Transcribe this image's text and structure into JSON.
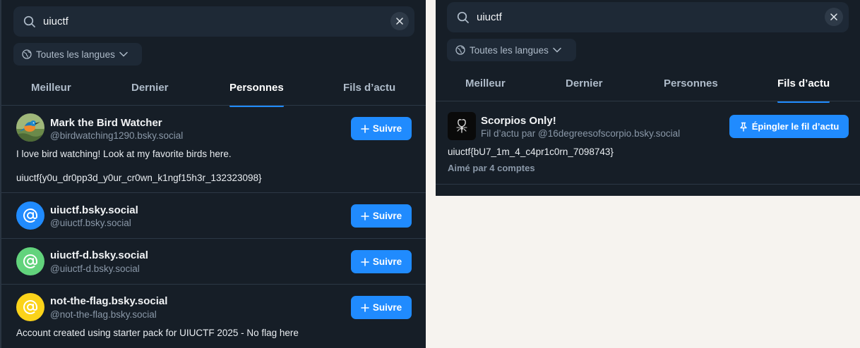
{
  "left": {
    "search": {
      "query": "uiuctf"
    },
    "language_filter": {
      "label": "Toutes les langues"
    },
    "tabs": [
      {
        "label": "Meilleur"
      },
      {
        "label": "Dernier"
      },
      {
        "label": "Personnes",
        "active": true
      },
      {
        "label": "Fils d’actu"
      }
    ],
    "follow_label": "Suivre",
    "people": [
      {
        "name": "Mark the Bird Watcher",
        "handle": "@birdwatching1290.bsky.social",
        "bio_line1": "I love bird watching! Look at my favorite birds here.",
        "bio_line2": "uiuctf{y0u_dr0pp3d_y0ur_cr0wn_k1ngf15h3r_132323098}",
        "avatar": "bird-photo"
      },
      {
        "name": "uiuctf.bsky.social",
        "handle": "@uiuctf.bsky.social",
        "avatar": "at-sign",
        "avatar_color": "#208bfe"
      },
      {
        "name": "uiuctf-d.bsky.social",
        "handle": "@uiuctf-d.bsky.social",
        "avatar": "at-sign",
        "avatar_color": "#62d37c"
      },
      {
        "name": "not-the-flag.bsky.social",
        "handle": "@not-the-flag.bsky.social",
        "bio_line1": "Account created using starter pack for UIUCTF 2025 - No flag here",
        "avatar": "at-sign",
        "avatar_color": "#fbd31a"
      }
    ]
  },
  "right": {
    "search": {
      "query": "uiuctf"
    },
    "language_filter": {
      "label": "Toutes les langues"
    },
    "tabs": [
      {
        "label": "Meilleur"
      },
      {
        "label": "Dernier"
      },
      {
        "label": "Personnes"
      },
      {
        "label": "Fils d’actu",
        "active": true
      }
    ],
    "feed": {
      "name": "Scorpios Only!",
      "byline": "Fil d’actu par @16degreesofscorpio.bsky.social",
      "description": "uiuctf{bU7_1m_4_c4pr1c0rn_7098743}",
      "likes": "Aimé par 4 comptes",
      "pin_label": "Épingler le fil d’actu"
    }
  },
  "colors": {
    "accent": "#208bfe",
    "panel_bg": "#161e27",
    "outside_bg": "#f6f3ef"
  }
}
